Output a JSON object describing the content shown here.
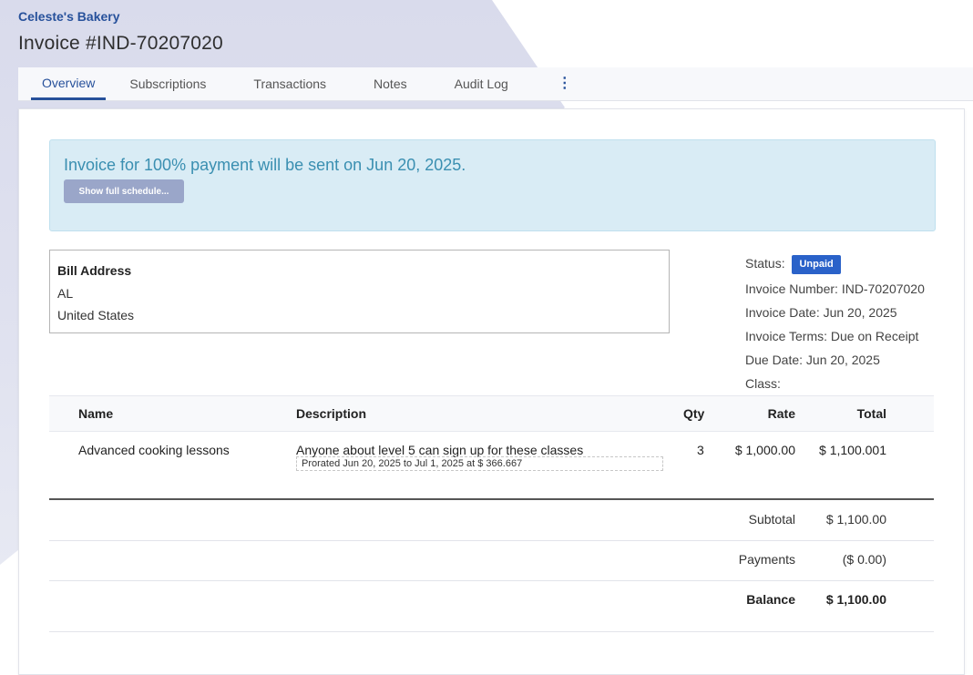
{
  "header": {
    "company": "Celeste's Bakery",
    "title": "Invoice #IND-70207020"
  },
  "tabs": [
    {
      "label": "Overview",
      "active": true
    },
    {
      "label": "Subscriptions"
    },
    {
      "label": "Transactions"
    },
    {
      "label": "Notes"
    },
    {
      "label": "Audit Log"
    }
  ],
  "more_menu_icon": "vertical-ellipsis-icon",
  "alert": {
    "text": "Invoice for 100% payment will be sent on Jun 20, 2025.",
    "button_label": "Show full schedule..."
  },
  "bill_address": {
    "title": "Bill Address",
    "line1": "AL",
    "line2": "United States"
  },
  "meta": {
    "status_label": "Status:",
    "status_badge": "Unpaid",
    "invoice_number": "Invoice Number: IND-70207020",
    "invoice_date": "Invoice Date: Jun 20, 2025",
    "invoice_terms": "Invoice Terms: Due on Receipt",
    "due_date": "Due Date: Jun 20, 2025",
    "class": "Class:"
  },
  "table": {
    "headers": {
      "name": "Name",
      "description": "Description",
      "qty": "Qty",
      "rate": "Rate",
      "total": "Total"
    },
    "rows": [
      {
        "name": "Advanced cooking lessons",
        "description": "Anyone about level 5 can sign up for these classes",
        "proration": "Prorated Jun 20, 2025 to Jul 1, 2025 at $ 366.667",
        "qty": "3",
        "rate": "$ 1,000.00",
        "total": "$ 1,100.001"
      }
    ]
  },
  "summary": {
    "subtotal_label": "Subtotal",
    "subtotal_value": "$ 1,100.00",
    "payments_label": "Payments",
    "payments_value": "($ 0.00)",
    "balance_label": "Balance",
    "balance_value": "$ 1,100.00"
  },
  "colors": {
    "brand": "#27519b",
    "badge": "#2a62c9",
    "alert_bg": "#d9ecf5",
    "alert_text": "#3a8fb1",
    "button": "#9aa6c9"
  }
}
